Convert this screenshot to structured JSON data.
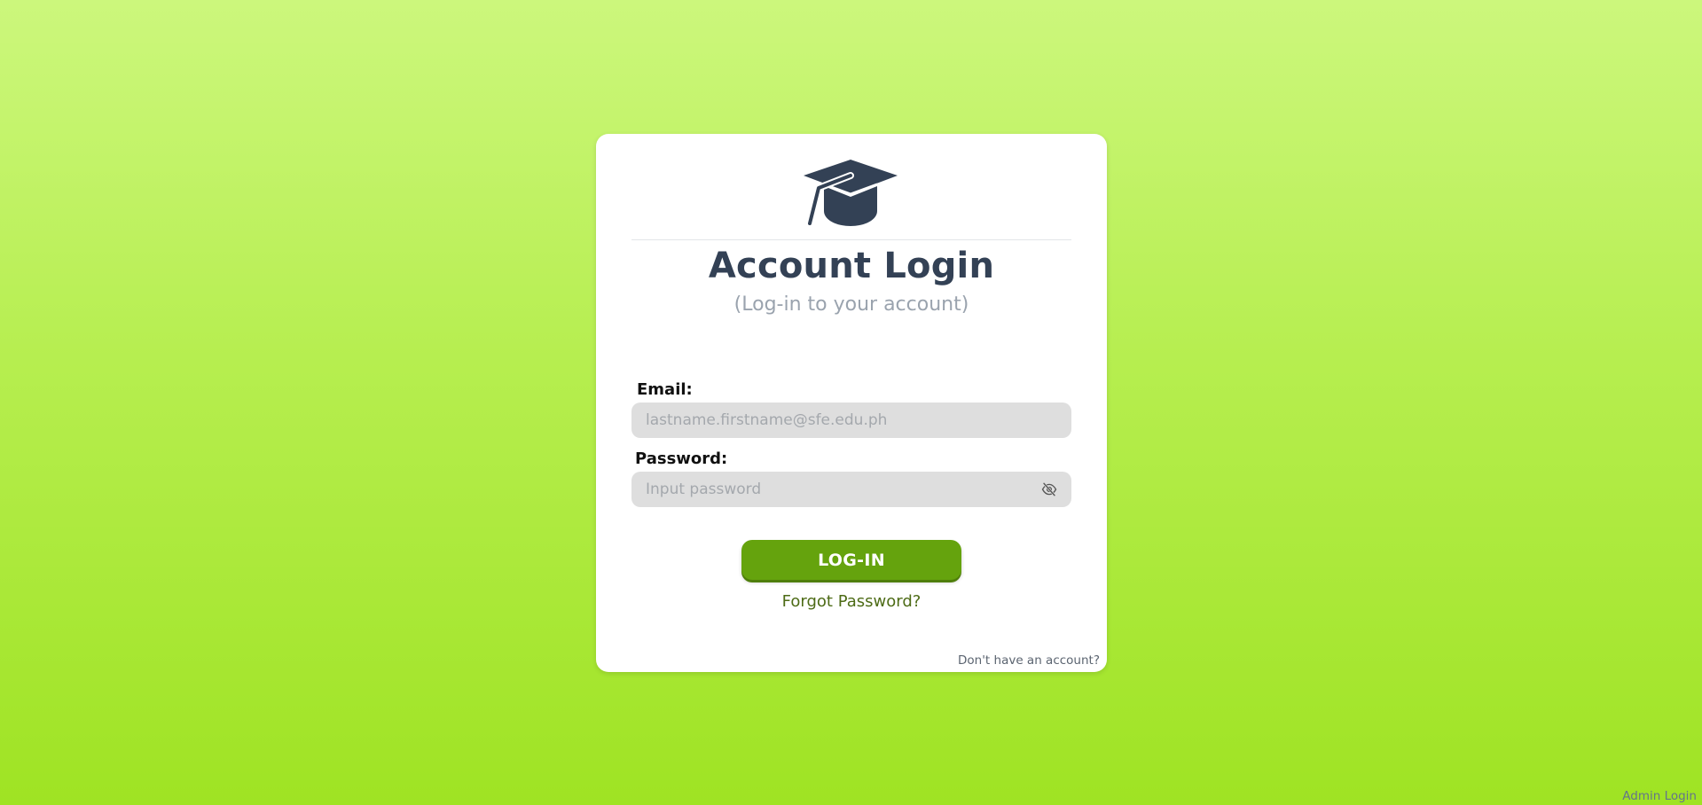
{
  "login_card": {
    "logo_icon": "graduation-cap-icon",
    "title": "Account Login",
    "subtitle": "(Log-in to your account)",
    "email": {
      "label": "Email:",
      "placeholder": "lastname.firstname@sfe.edu.ph",
      "value": ""
    },
    "password": {
      "label": "Password:",
      "placeholder": "Input password",
      "value": "",
      "toggle_icon": "eye-slash-icon"
    },
    "login_button_label": "LOG-IN",
    "forgot_password_link": "Forgot Password?",
    "signup_link": "Don't have an account?"
  },
  "admin_login_link": "Admin Login",
  "colors": {
    "background_top": "#ccf77c",
    "background_bottom": "#9fe323",
    "primary_button": "#65a30d",
    "title_text": "#334155",
    "input_background": "#dedede"
  }
}
